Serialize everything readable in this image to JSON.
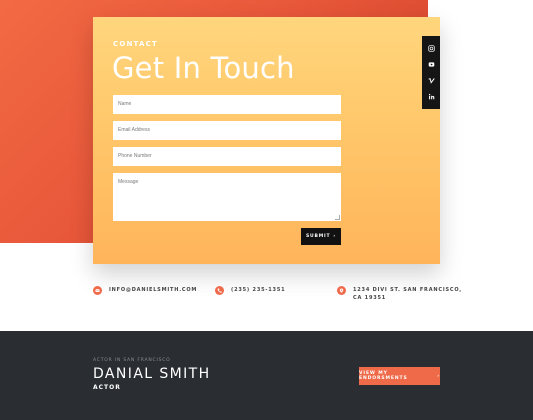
{
  "contact": {
    "eyebrow": "CONTACT",
    "title": "Get In Touch",
    "fields": {
      "name_placeholder": "Name",
      "email_placeholder": "Email Address",
      "phone_placeholder": "Phone Number",
      "message_placeholder": "Message"
    },
    "submit_label": "SUBMIT",
    "submit_arrow": "›"
  },
  "social": [
    "instagram-icon",
    "youtube-icon",
    "vimeo-icon",
    "linkedin-icon"
  ],
  "info": {
    "email": "INFO@DANIELSMITH.COM",
    "phone": "(235) 235-1351",
    "address_line1": "1234 DIVI ST. SAN FRANCISCO,",
    "address_line2": "CA 19351"
  },
  "footer": {
    "eyebrow": "ACTOR IN SAN FRANCISCO",
    "name": "DANIAL SMITH",
    "role": "ACTOR",
    "button_label": "VIEW MY ENDORSMENTS",
    "button_arrow": "›"
  },
  "colors": {
    "accent": "#ee6a48",
    "card_top": "#ffd67d",
    "card_bottom": "#ffb45a",
    "footer_bg": "#2a2e33"
  }
}
